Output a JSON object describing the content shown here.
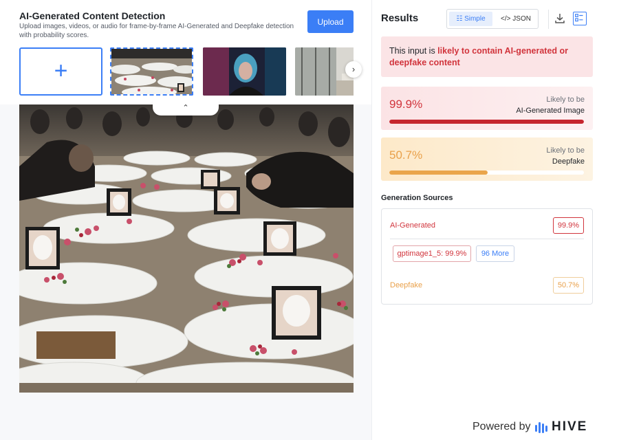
{
  "header": {
    "title": "AI-Generated Content Detection",
    "subtitle": "Upload images, videos, or audio for frame-by-frame AI-Generated and Deepfake detection with probability scores.",
    "upload_label": "Upload"
  },
  "thumbnails": {
    "add_symbol": "+",
    "next_symbol": "›",
    "collapse_symbol": "⌃"
  },
  "results": {
    "title": "Results",
    "toggle": {
      "simple_label": "Simple",
      "json_label": "</> JSON"
    },
    "alert_prefix": "This input is ",
    "alert_highlight": "likely to contain AI-generated or deepfake content",
    "ai_card": {
      "percent": "99.9%",
      "likely_label": "Likely to be",
      "category": "AI-Generated Image",
      "level": 0.999
    },
    "deepfake_card": {
      "percent": "50.7%",
      "likely_label": "Likely to be",
      "category": "Deepfake",
      "level": 0.507
    },
    "generation_sources": {
      "title": "Generation Sources",
      "ai_label": "AI-Generated",
      "ai_percent": "99.9%",
      "model_chip": "gptimage1_5: 99.9%",
      "more_chip": "96 More",
      "deepfake_label": "Deepfake",
      "deepfake_percent": "50.7%"
    }
  },
  "footer": {
    "powered_by": "Powered by",
    "brand": "HIVE"
  },
  "colors": {
    "accent": "#3b7ef6",
    "ai_red": "#d1343c",
    "deepfake_orange": "#e9a04a"
  }
}
